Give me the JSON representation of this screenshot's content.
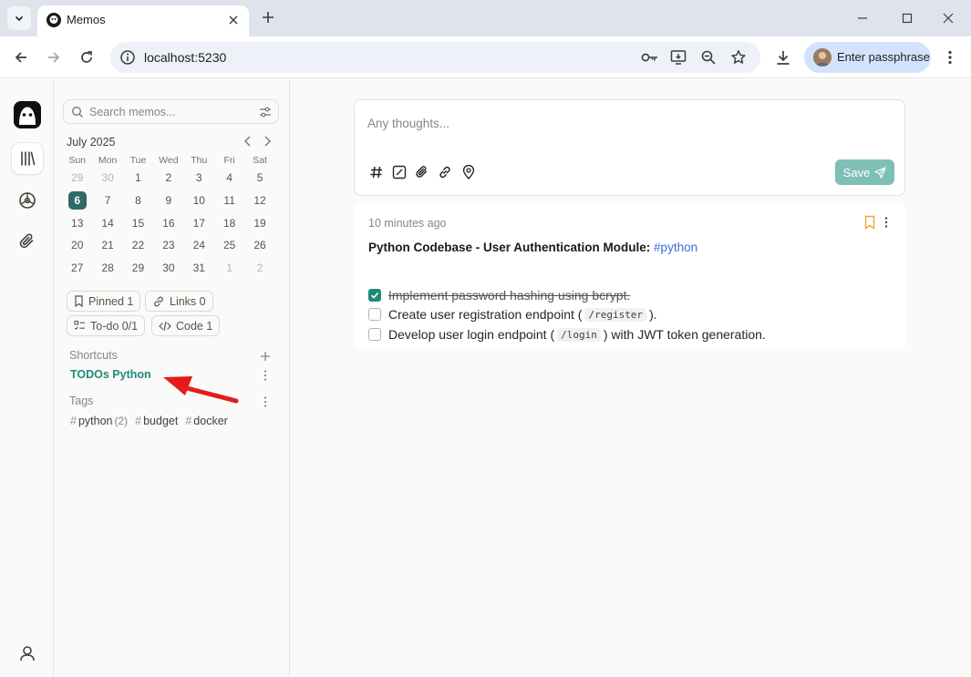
{
  "browser": {
    "tab_title": "Memos",
    "url": "localhost:5230",
    "profile_label": "Enter passphrase",
    "icons": [
      "tab-search-icon",
      "close-icon",
      "plus-icon",
      "minimize-icon",
      "maximize-icon",
      "close-window-icon",
      "back-icon",
      "forward-icon",
      "reload-icon",
      "site-info-icon",
      "key-icon",
      "install-app-icon",
      "zoom-icon",
      "star-icon",
      "download-icon",
      "kebab-menu-icon"
    ]
  },
  "rail": {
    "items": [
      "app-logo",
      "memos-icon",
      "explore-icon",
      "attachments-icon",
      "user-icon"
    ]
  },
  "sidebar": {
    "search_placeholder": "Search memos...",
    "calendar": {
      "month_label": "July 2025",
      "weekdays": [
        "Sun",
        "Mon",
        "Tue",
        "Wed",
        "Thu",
        "Fri",
        "Sat"
      ],
      "weeks": [
        [
          "29",
          "30",
          "1",
          "2",
          "3",
          "4",
          "5"
        ],
        [
          "6",
          "7",
          "8",
          "9",
          "10",
          "11",
          "12"
        ],
        [
          "13",
          "14",
          "15",
          "16",
          "17",
          "18",
          "19"
        ],
        [
          "20",
          "21",
          "22",
          "23",
          "24",
          "25",
          "26"
        ],
        [
          "27",
          "28",
          "29",
          "30",
          "31",
          "1",
          "2"
        ]
      ],
      "today": "6"
    },
    "stats": {
      "pinned": "Pinned 1",
      "links": "Links 0",
      "todo": "To-do 0/1",
      "code": "Code 1"
    },
    "shortcuts_title": "Shortcuts",
    "shortcut_item": "TODOs Python",
    "tags_title": "Tags",
    "tags": [
      {
        "name": "python",
        "count": "(2)"
      },
      {
        "name": "budget",
        "count": ""
      },
      {
        "name": "docker",
        "count": ""
      }
    ]
  },
  "editor": {
    "placeholder": "Any thoughts...",
    "save_label": "Save"
  },
  "memo": {
    "timestamp": "10 minutes ago",
    "title_bold": "Python Codebase - User Authentication Module:",
    "title_tag": "#python",
    "todos": [
      {
        "checked": true,
        "text": "Implement password hashing using bcrypt."
      },
      {
        "checked": false,
        "before": "Create user registration endpoint (",
        "code": "/register",
        "after": ")."
      },
      {
        "checked": false,
        "before": "Develop user login endpoint (",
        "code": "/login",
        "after": ") with JWT token generation."
      }
    ]
  },
  "colors": {
    "accent": "#1f8a7a",
    "today_bg": "#2f6b64",
    "save_bg": "#7fbfb6",
    "hashtag": "#3b6fd6",
    "annotation_arrow": "#e51b1b"
  }
}
